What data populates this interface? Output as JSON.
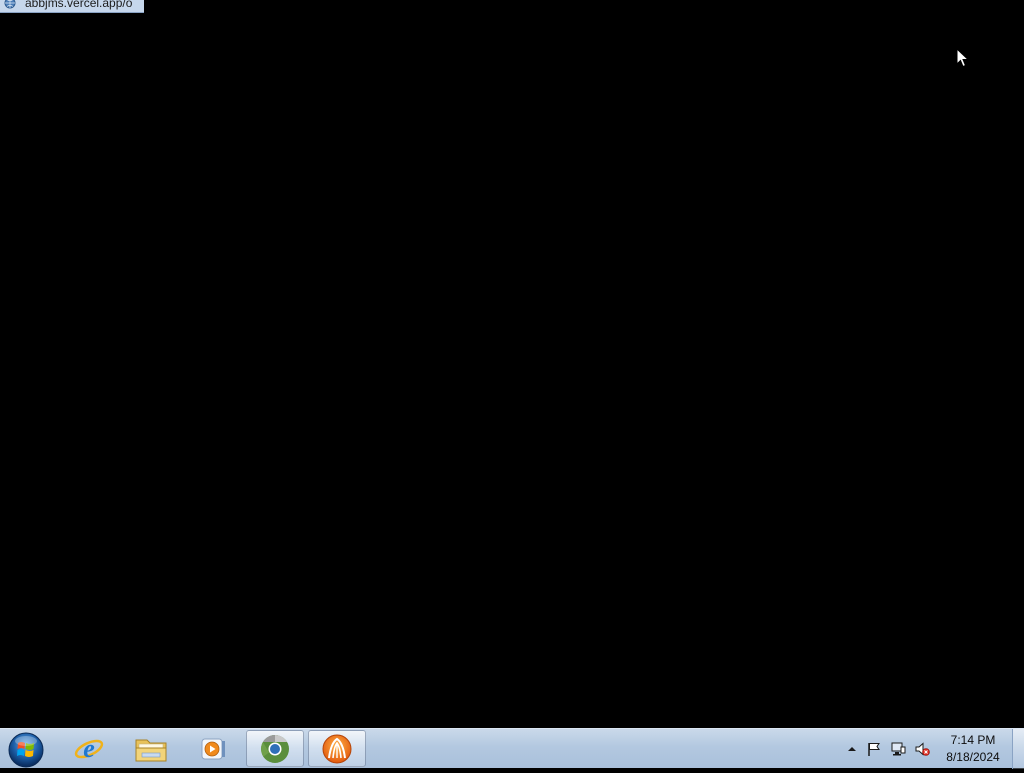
{
  "fullscreen_tab": {
    "url": "abbjms.vercel.app/o"
  },
  "taskbar": {
    "start_button_label": "Start",
    "pinned": [
      {
        "name": "Internet Explorer",
        "icon": "internet-explorer-icon"
      },
      {
        "name": "Windows Explorer",
        "icon": "folder-icon"
      },
      {
        "name": "Windows Media Player",
        "icon": "media-player-icon"
      },
      {
        "name": "Google Chrome",
        "icon": "chrome-icon",
        "active": true
      },
      {
        "name": "Bitcoin Core",
        "icon": "app-orange-icon",
        "active": true
      }
    ],
    "tray": {
      "icons": [
        "show-hidden-icons-arrow",
        "action-center-flag-icon",
        "network-icon",
        "volume-muted-icon"
      ]
    },
    "clock": {
      "time": "7:14 PM",
      "date": "8/18/2024"
    }
  },
  "colors": {
    "desktop_background": "#000000",
    "taskbar_gradient_top": "#cad9ea",
    "taskbar_gradient_bottom": "#a9c0db"
  }
}
